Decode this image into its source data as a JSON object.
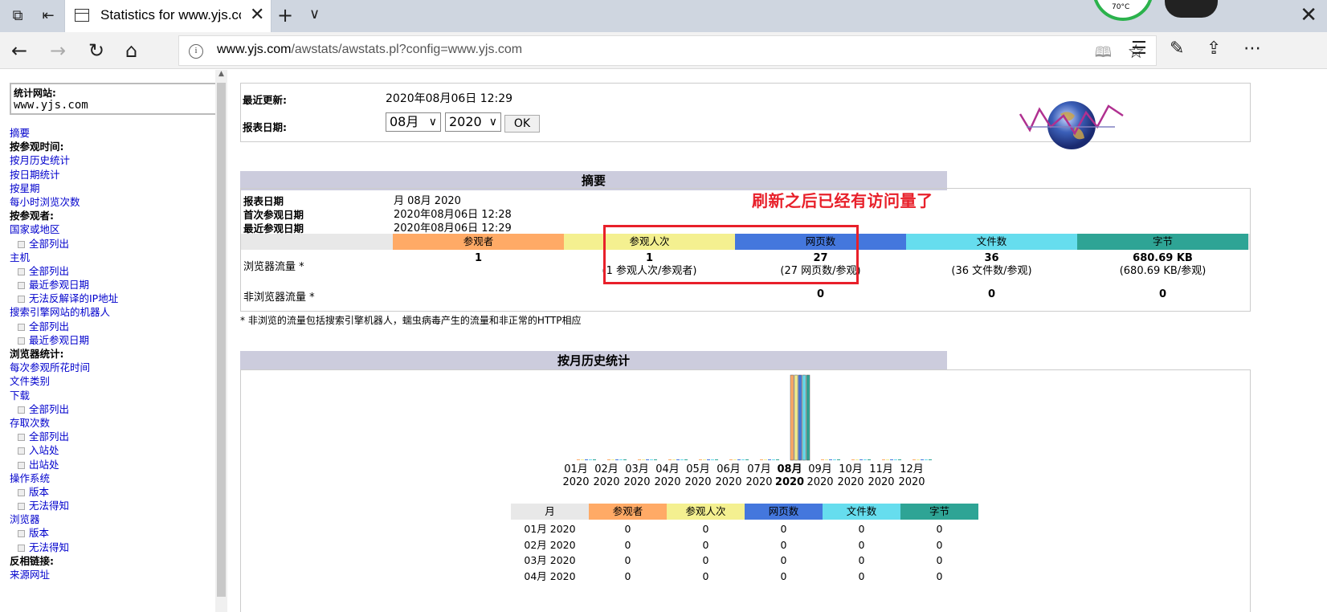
{
  "browser": {
    "tab_title": "Statistics for www.yjs.co",
    "url_domain": "www.yjs.com",
    "url_path": "/awstats/awstats.pl?config=www.yjs.com",
    "temp_badge": "70°C"
  },
  "sidebar": {
    "site_label": "统计网站:",
    "site_name": "www.yjs.com",
    "items": [
      {
        "label": "摘要",
        "kind": "link"
      },
      {
        "label": "按参观时间:",
        "kind": "head"
      },
      {
        "label": "按月历史统计",
        "kind": "link"
      },
      {
        "label": "按日期统计",
        "kind": "link"
      },
      {
        "label": "按星期",
        "kind": "link"
      },
      {
        "label": "每小时浏览次数",
        "kind": "link"
      },
      {
        "label": "按参观者:",
        "kind": "head"
      },
      {
        "label": "国家或地区",
        "kind": "link"
      },
      {
        "label": "全部列出",
        "kind": "sub"
      },
      {
        "label": "主机",
        "kind": "link"
      },
      {
        "label": "全部列出",
        "kind": "sub"
      },
      {
        "label": "最近参观日期",
        "kind": "sub"
      },
      {
        "label": "无法反解译的IP地址",
        "kind": "sub"
      },
      {
        "label": "搜索引擎网站的机器人",
        "kind": "link"
      },
      {
        "label": "全部列出",
        "kind": "sub"
      },
      {
        "label": "最近参观日期",
        "kind": "sub"
      },
      {
        "label": "浏览器统计:",
        "kind": "head"
      },
      {
        "label": "每次参观所花时间",
        "kind": "link"
      },
      {
        "label": "文件类别",
        "kind": "link"
      },
      {
        "label": "下载",
        "kind": "link"
      },
      {
        "label": "全部列出",
        "kind": "sub"
      },
      {
        "label": "存取次数",
        "kind": "link"
      },
      {
        "label": "全部列出",
        "kind": "sub"
      },
      {
        "label": "入站处",
        "kind": "sub"
      },
      {
        "label": "出站处",
        "kind": "sub"
      },
      {
        "label": "操作系统",
        "kind": "link"
      },
      {
        "label": "版本",
        "kind": "sub"
      },
      {
        "label": "无法得知",
        "kind": "sub"
      },
      {
        "label": "浏览器",
        "kind": "link"
      },
      {
        "label": "版本",
        "kind": "sub"
      },
      {
        "label": "无法得知",
        "kind": "sub"
      },
      {
        "label": "反相链接:",
        "kind": "head"
      },
      {
        "label": "来源网址",
        "kind": "link"
      }
    ]
  },
  "header": {
    "updated_label": "最近更新:",
    "updated_value": "2020年08月06日 12:29",
    "period_label": "报表日期:",
    "month_select": "08月",
    "year_select": "2020",
    "ok_label": "OK"
  },
  "summary": {
    "title": "摘要",
    "rows": [
      {
        "label": "报表日期",
        "value": "月 08月 2020"
      },
      {
        "label": "首次参观日期",
        "value": "2020年08月06日 12:28"
      },
      {
        "label": "最近参观日期",
        "value": "2020年08月06日 12:29"
      }
    ],
    "columns": [
      "参观者",
      "参观人次",
      "网页数",
      "文件数",
      "字节"
    ],
    "column_colors": [
      "#ffaa66",
      "#f4f090",
      "#4477dd",
      "#66ddee",
      "#2ea495"
    ],
    "browser_label": "浏览器流量 *",
    "browser_values": [
      "1",
      "1",
      "27",
      "36",
      "680.69 KB"
    ],
    "browser_sub": [
      "",
      "(1 参观人次/参观者)",
      "(27 网页数/参观)",
      "(36 文件数/参观)",
      "(680.69 KB/参观)"
    ],
    "nonbrowser_label": "非浏览器流量 *",
    "nonbrowser_values": [
      "",
      "",
      "0",
      "0",
      "0"
    ],
    "note": "* 非浏览的流量包括搜索引擎机器人，蠕虫病毒产生的流量和非正常的HTTP相应"
  },
  "annotation": {
    "text": "刷新之后已经有访问量了",
    "color": "#e8202a"
  },
  "monthly": {
    "title": "按月历史统计",
    "months": [
      "01月",
      "02月",
      "03月",
      "04月",
      "05月",
      "06月",
      "07月",
      "08月",
      "09月",
      "10月",
      "11月",
      "12月"
    ],
    "year": "2020",
    "highlight_month_index": 7,
    "table_headers": [
      "月",
      "参观者",
      "参观人次",
      "网页数",
      "文件数",
      "字节"
    ],
    "table_rows": [
      [
        "01月 2020",
        "0",
        "0",
        "0",
        "0",
        "0"
      ],
      [
        "02月 2020",
        "0",
        "0",
        "0",
        "0",
        "0"
      ],
      [
        "03月 2020",
        "0",
        "0",
        "0",
        "0",
        "0"
      ],
      [
        "04月 2020",
        "0",
        "0",
        "0",
        "0",
        "0"
      ]
    ]
  },
  "chart_data": {
    "type": "bar",
    "categories": [
      "01月 2020",
      "02月 2020",
      "03月 2020",
      "04月 2020",
      "05月 2020",
      "06月 2020",
      "07月 2020",
      "08月 2020",
      "09月 2020",
      "10月 2020",
      "11月 2020",
      "12月 2020"
    ],
    "series": [
      {
        "name": "参观者",
        "color": "#ffaa66",
        "values": [
          0,
          0,
          0,
          0,
          0,
          0,
          0,
          1,
          0,
          0,
          0,
          0
        ]
      },
      {
        "name": "参观人次",
        "color": "#f4f090",
        "values": [
          0,
          0,
          0,
          0,
          0,
          0,
          0,
          1,
          0,
          0,
          0,
          0
        ]
      },
      {
        "name": "网页数",
        "color": "#4477dd",
        "values": [
          0,
          0,
          0,
          0,
          0,
          0,
          0,
          27,
          0,
          0,
          0,
          0
        ]
      },
      {
        "name": "文件数",
        "color": "#66ddee",
        "values": [
          0,
          0,
          0,
          0,
          0,
          0,
          0,
          36,
          0,
          0,
          0,
          0
        ]
      },
      {
        "name": "字节",
        "color": "#2ea495",
        "values": [
          0,
          0,
          0,
          0,
          0,
          0,
          0,
          680.69,
          0,
          0,
          0,
          0
        ]
      }
    ],
    "title": "",
    "xlabel": "",
    "ylabel": ""
  }
}
